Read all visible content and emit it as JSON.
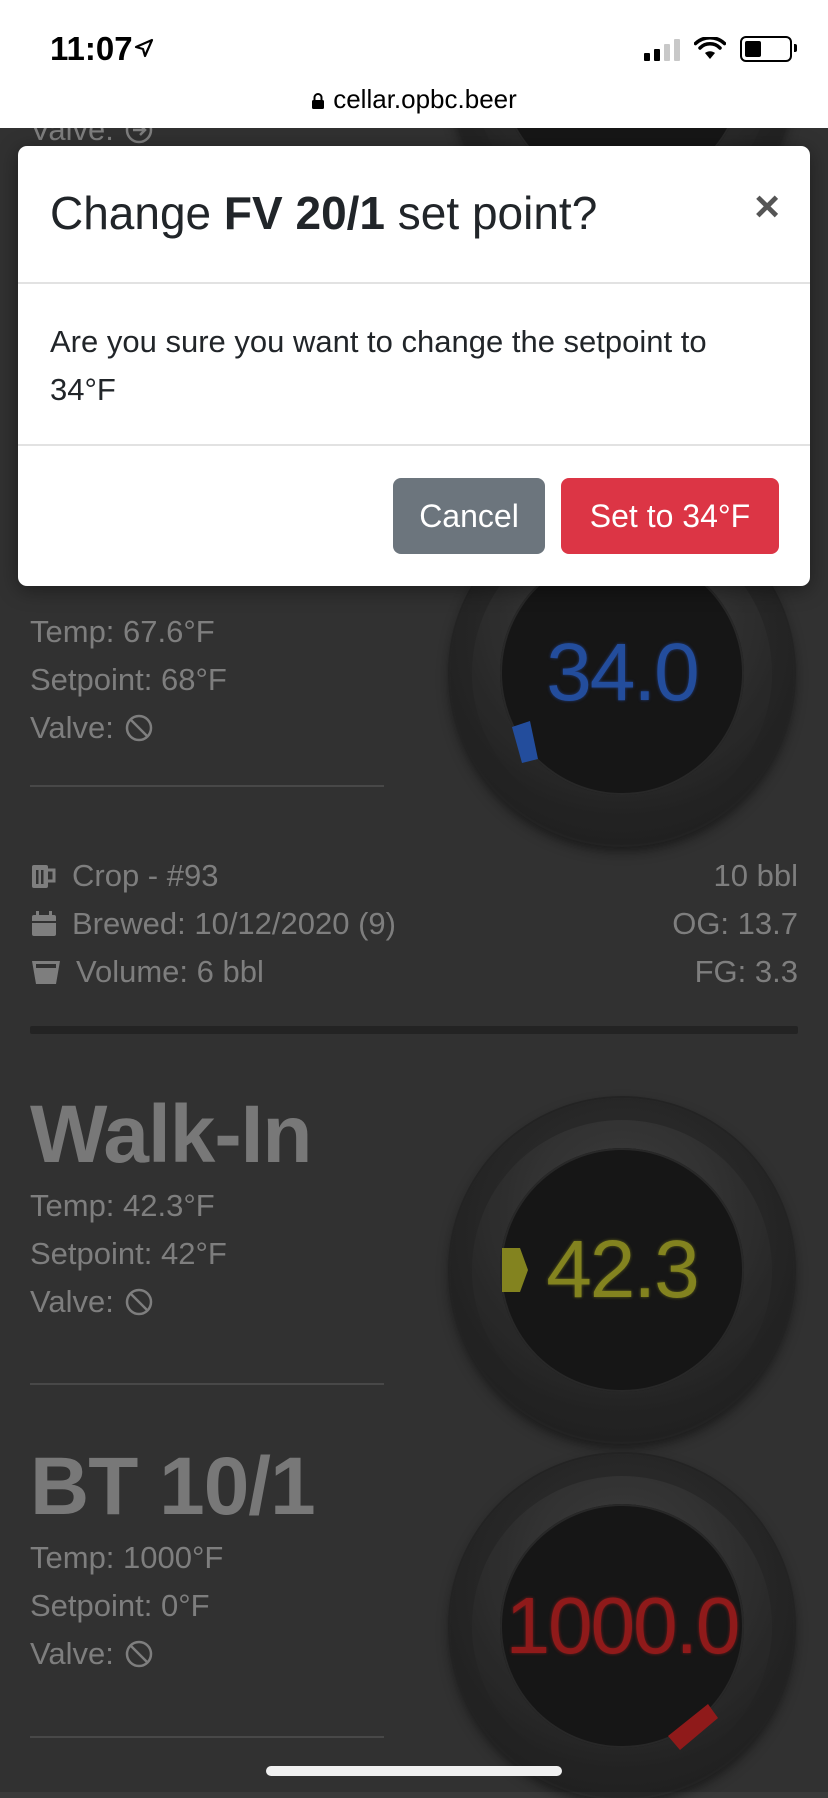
{
  "status": {
    "time": "11:07",
    "url": "cellar.opbc.beer"
  },
  "top_partial": {
    "valve_label": "Valve:"
  },
  "modal": {
    "title_prefix": "Change ",
    "title_tank": "FV 20/1",
    "title_suffix": " set point?",
    "close_label": "×",
    "body": "Are you sure you want to change the setpoint to 34°F",
    "cancel_label": "Cancel",
    "confirm_label": "Set to 34°F"
  },
  "tank_fv": {
    "temp": "Temp: 67.6°F",
    "setpoint": "Setpoint: 68°F",
    "valve_label": "Valve:",
    "gauge_reading": "34.0"
  },
  "batch": {
    "beer": "Crop - #93",
    "brewed": "Brewed: 10/12/2020 (9)",
    "volume": "Volume: 6 bbl",
    "capacity": "10 bbl",
    "og": "OG: 13.7",
    "fg": "FG: 3.3"
  },
  "tank_walkin": {
    "name": "Walk-In",
    "temp": "Temp: 42.3°F",
    "setpoint": "Setpoint: 42°F",
    "valve_label": "Valve:",
    "gauge_reading": "42.3"
  },
  "tank_bt": {
    "name": "BT 10/1",
    "temp": "Temp: 1000°F",
    "setpoint": "Setpoint: 0°F",
    "valve_label": "Valve:",
    "gauge_reading": "1000.0"
  },
  "colors": {
    "danger": "#dc3545",
    "secondary": "#6c757d",
    "gauge_blue": "#2a5bb8",
    "gauge_yellow": "#9a9a25",
    "gauge_red": "#a81f1f"
  }
}
